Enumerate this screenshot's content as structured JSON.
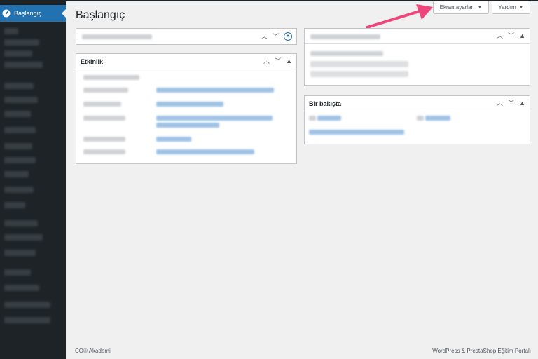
{
  "sidebar": {
    "active_label": "Başlangıç",
    "active_icon": "dashboard-icon"
  },
  "header": {
    "title": "Başlangıç",
    "screen_options_label": "Ekran ayarları",
    "help_label": "Yardım"
  },
  "boxes": {
    "activity_title": "Etkinlik",
    "glance_title": "Bir bakışta"
  },
  "footer": {
    "left": "CO® Akademi",
    "right": "WordPress & PrestaShop Eğitim Portalı"
  },
  "colors": {
    "sidebar_bg": "#1d2327",
    "accent": "#2271b1",
    "arrow": "#f0457a"
  }
}
